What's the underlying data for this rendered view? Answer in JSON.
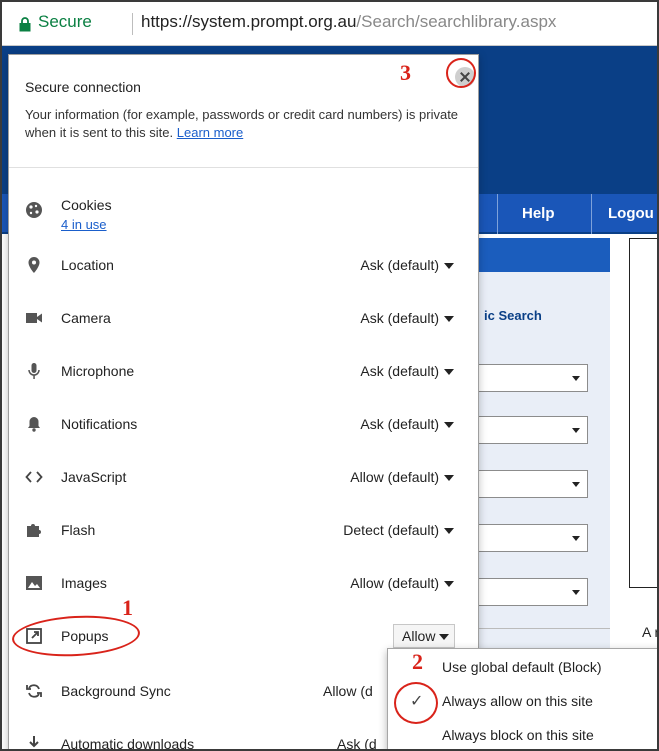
{
  "address_bar": {
    "secure_label": "Secure",
    "url_host": "https://system.prompt.org.au",
    "url_path": "/Search/searchlibrary.aspx"
  },
  "background_page": {
    "nav": {
      "help": "Help",
      "logout": "Logou"
    },
    "panel_title": "ic Search",
    "right_text": "A r"
  },
  "site_info": {
    "title": "Secure connection",
    "description": "Your information (for example, passwords or credit card numbers) is private when it is sent to this site.",
    "learn_more": "Learn more",
    "cookies": {
      "label": "Cookies",
      "in_use": "4 in use"
    },
    "permissions": [
      {
        "label": "Location",
        "value": "Ask (default)",
        "icon": "location-icon"
      },
      {
        "label": "Camera",
        "value": "Ask (default)",
        "icon": "camera-icon"
      },
      {
        "label": "Microphone",
        "value": "Ask (default)",
        "icon": "microphone-icon"
      },
      {
        "label": "Notifications",
        "value": "Ask (default)",
        "icon": "bell-icon"
      },
      {
        "label": "JavaScript",
        "value": "Allow (default)",
        "icon": "code-icon"
      },
      {
        "label": "Flash",
        "value": "Detect (default)",
        "icon": "puzzle-icon"
      },
      {
        "label": "Images",
        "value": "Allow (default)",
        "icon": "image-icon"
      },
      {
        "label": "Popups",
        "value": "Allow",
        "icon": "popup-icon"
      },
      {
        "label": "Background Sync",
        "value": "Allow (d",
        "icon": "sync-icon"
      },
      {
        "label": "Automatic downloads",
        "value": "Ask (d",
        "icon": "download-icon"
      }
    ]
  },
  "popups_dropdown": {
    "options": [
      "Use global default (Block)",
      "Always allow on this site",
      "Always block on this site"
    ],
    "selected": "Always allow on this site"
  },
  "annotations": {
    "one": "1",
    "two": "2",
    "three": "3"
  },
  "colors": {
    "annotation": "#d9231a",
    "secure": "#0b8043",
    "link": "#1a5ecb",
    "site_header": "#0a3f86"
  }
}
